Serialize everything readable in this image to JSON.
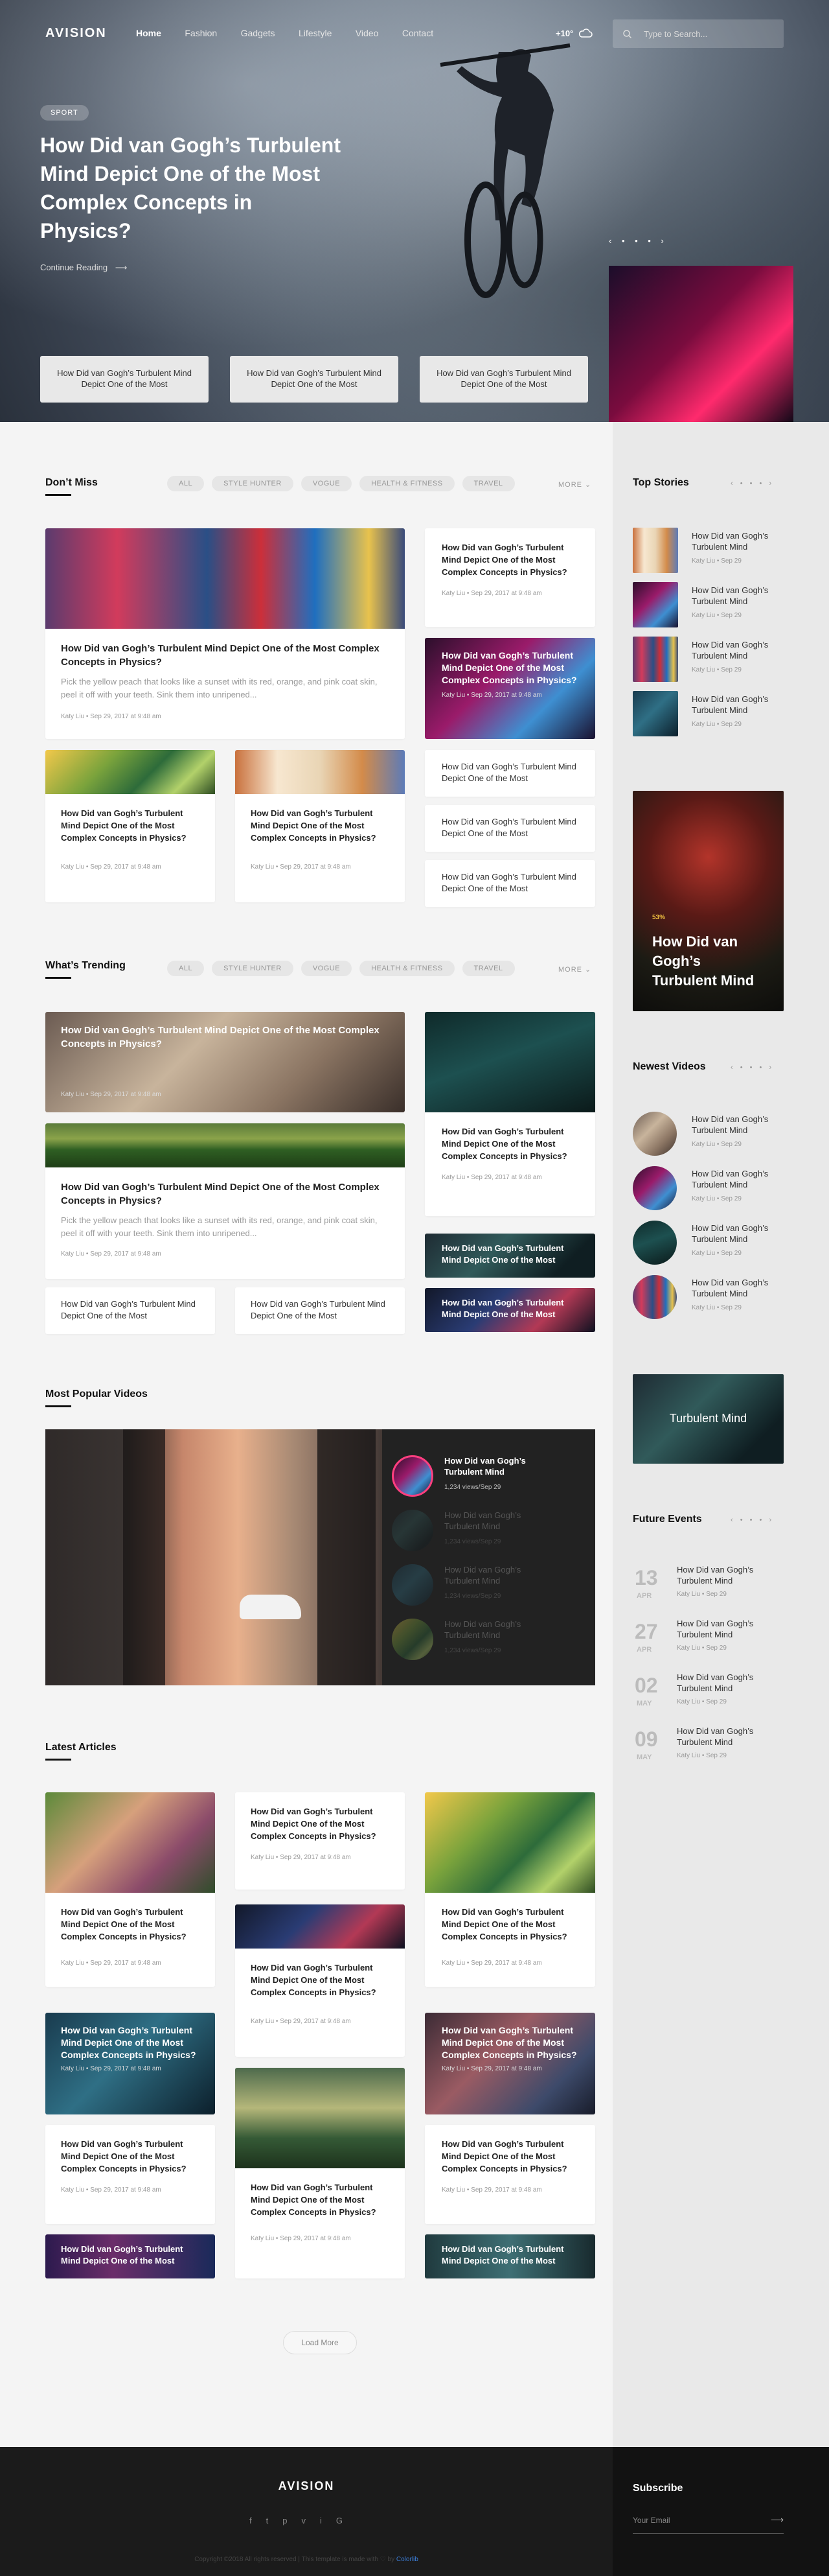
{
  "header": {
    "logo": "AVISION",
    "nav": [
      "Home",
      "Fashion",
      "Gadgets",
      "Lifestyle",
      "Video",
      "Contact"
    ],
    "weather": "+10°",
    "search_placeholder": "Type to Search..."
  },
  "hero": {
    "tag": "SPORT",
    "title": "How Did van Gogh’s Turbulent Mind Depict One of the Most Complex Concepts in Physics?",
    "continue": "Continue Reading",
    "cards": [
      "How Did van Gogh’s Turbulent Mind Depict One of the Most",
      "How Did van Gogh’s Turbulent Mind Depict One of the Most",
      "How Did van Gogh’s Turbulent Mind Depict One of the Most"
    ]
  },
  "filters": [
    "ALL",
    "STYLE HUNTER",
    "VOGUE",
    "HEALTH & FITNESS",
    "TRAVEL"
  ],
  "more": "MORE",
  "dont_miss": {
    "title": "Don’t Miss",
    "main_title": "How Did van Gogh’s Turbulent Mind Depict One of the Most Complex Concepts in Physics?",
    "main_excerpt": "Pick the yellow peach that looks like a sunset with its red, orange, and pink coat skin, peel it off with your teeth. Sink them into unripened...",
    "meta": "Katy Liu  •  Sep 29, 2017 at 9:48 am",
    "card_title": "How Did van Gogh’s Turbulent Mind Depict One of the Most Complex Concepts in Physics?",
    "short_title": "How Did van Gogh’s Turbulent Mind Depict One of the Most"
  },
  "trending": {
    "title": "What’s Trending"
  },
  "popular": {
    "title": "Most Popular Videos",
    "items": [
      {
        "title": "How Did van Gogh’s Turbulent Mind",
        "meta": "1,234 views/Sep 29"
      },
      {
        "title": "How Did van Gogh’s Turbulent Mind",
        "meta": "1,234 views/Sep 29"
      },
      {
        "title": "How Did van Gogh’s Turbulent Mind",
        "meta": "1,234 views/Sep 29"
      },
      {
        "title": "How Did van Gogh’s Turbulent Mind",
        "meta": "1,234 views/Sep 29"
      }
    ]
  },
  "latest": {
    "title": "Latest Articles",
    "load_more": "Load More"
  },
  "sidebar": {
    "top_stories": "Top Stories",
    "story_title": "How Did van Gogh’s Turbulent Mind",
    "story_meta": "Katy Liu  •  Sep 29",
    "promo_tag": "53%",
    "promo_title": "How Did van Gogh’s Turbulent Mind",
    "newest_videos": "Newest Videos",
    "banner_text": "Turbulent Mind",
    "future_events": "Future Events",
    "events": [
      {
        "day": "13",
        "month": "APR"
      },
      {
        "day": "27",
        "month": "APR"
      },
      {
        "day": "02",
        "month": "MAY"
      },
      {
        "day": "09",
        "month": "MAY"
      }
    ]
  },
  "footer": {
    "logo": "AVISION",
    "subscribe": "Subscribe",
    "email_placeholder": "Your Email",
    "social": [
      "f",
      "t",
      "p",
      "v",
      "i",
      "G"
    ],
    "copyright": "Copyright ©2018 All rights reserved | This template is made with ♡ by",
    "brand": "Colorlib"
  }
}
